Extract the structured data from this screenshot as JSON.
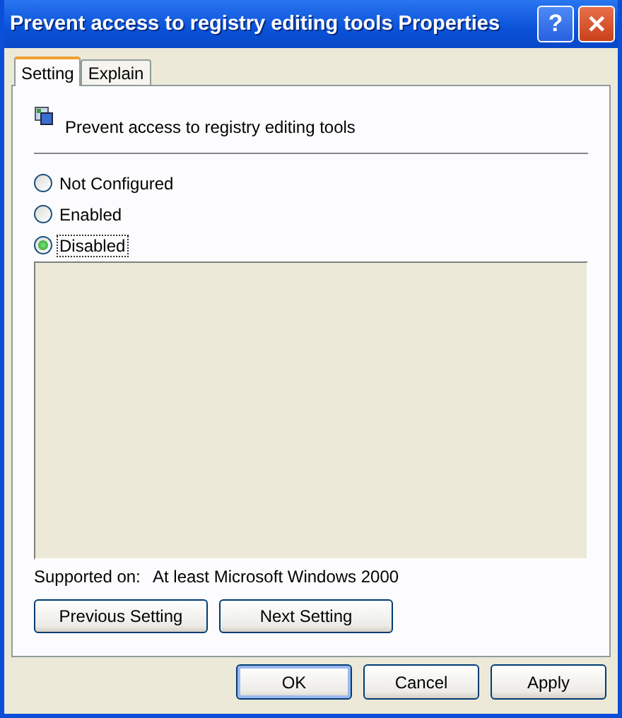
{
  "window": {
    "title": "Prevent access to registry editing tools Properties",
    "help_button": "?",
    "close_button": "✕"
  },
  "tabs": [
    {
      "label": "Setting",
      "selected": true
    },
    {
      "label": "Explain",
      "selected": false
    }
  ],
  "policy": {
    "name": "Prevent access to registry editing tools"
  },
  "options": [
    {
      "label": "Not Configured",
      "selected": false
    },
    {
      "label": "Enabled",
      "selected": false
    },
    {
      "label": "Disabled",
      "selected": true
    }
  ],
  "supported_on": {
    "label": "Supported on:",
    "value": "At least Microsoft Windows 2000"
  },
  "nav_buttons": [
    "Previous Setting",
    "Next Setting"
  ],
  "buttons": [
    {
      "label": "OK",
      "default": true
    },
    {
      "label": "Cancel",
      "default": false
    },
    {
      "label": "Apply",
      "default": false
    }
  ]
}
